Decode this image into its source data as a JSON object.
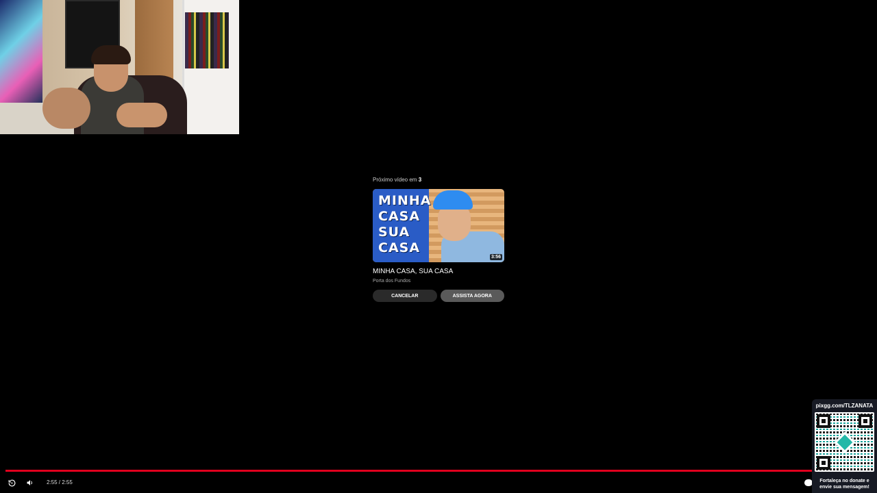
{
  "upnext": {
    "countdown_prefix": "Próximo vídeo em",
    "countdown_value": "3",
    "thumbnail_text": "MINHA\nCASA\nSUA\nCASA",
    "duration": "3:56",
    "title": "MINHA CASA, SUA CASA",
    "channel": "Porta dos Fundos",
    "cancel_label": "CANCELAR",
    "watch_label": "ASSISTA AGORA"
  },
  "player": {
    "time_display": "2:55 / 2:55",
    "progress_fraction": 1.0,
    "accent_color": "#e0001d",
    "icons": {
      "replay": "replay-icon",
      "volume": "volume-icon"
    }
  },
  "donation": {
    "url": "pixgg.com/TLZANATA",
    "message": "Fortaleça no donate e envie sua mensagem!"
  }
}
